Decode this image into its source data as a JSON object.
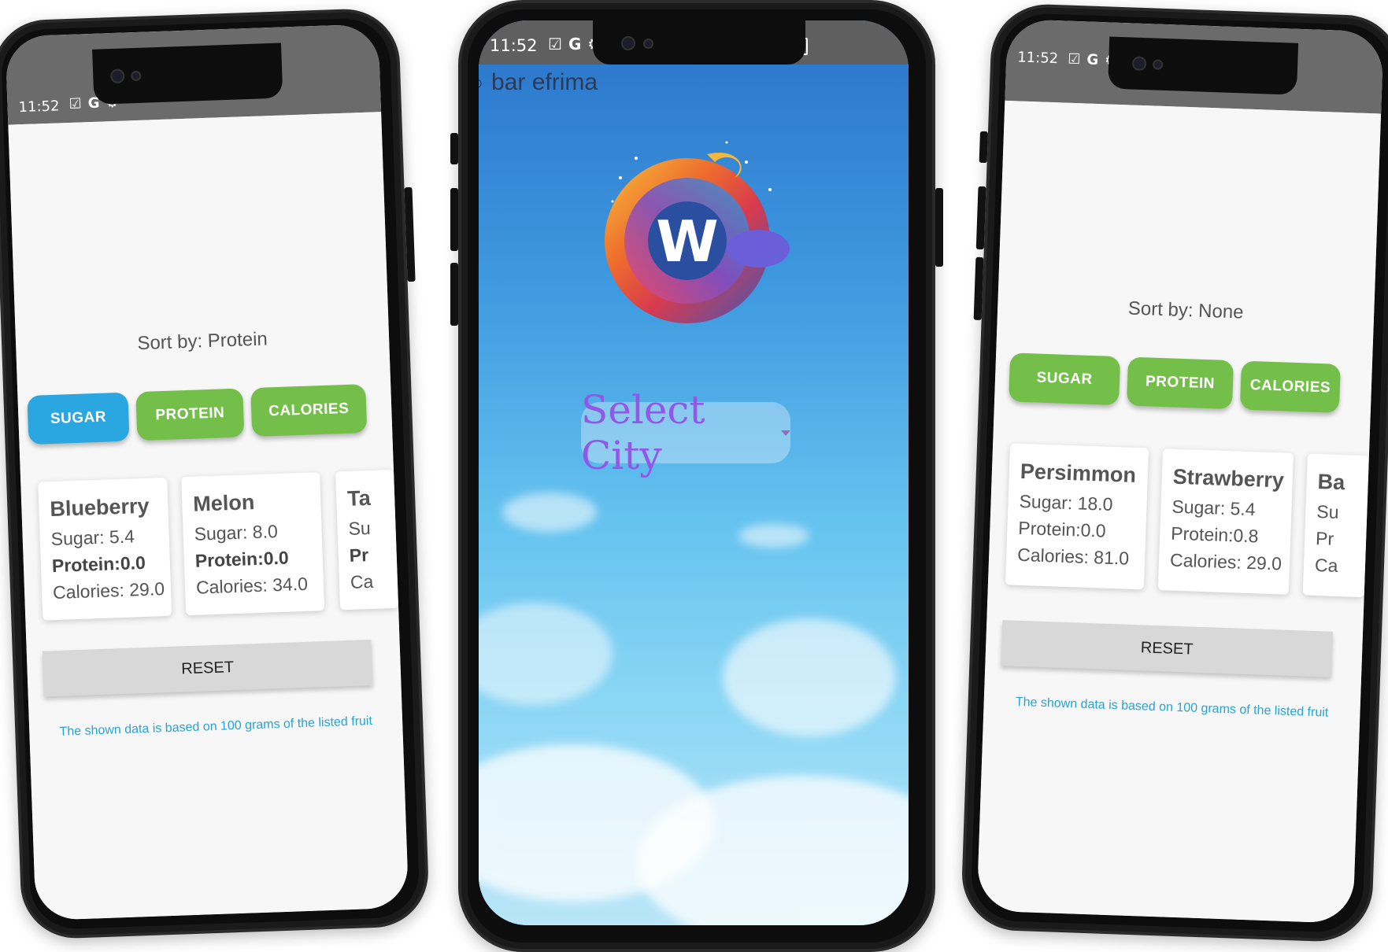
{
  "status_bar": {
    "time": "11:52"
  },
  "left_phone": {
    "sort_label": "Sort by: Protein",
    "buttons": [
      {
        "label": "SUGAR",
        "state": "active",
        "color": "#2aa6e0"
      },
      {
        "label": "PROTEIN",
        "state": "inactive",
        "color": "#74bf4a"
      },
      {
        "label": "CALORIES",
        "state": "inactive",
        "color": "#74bf4a"
      }
    ],
    "cards": [
      {
        "name": "Blueberry",
        "sugar": "Sugar: 5.4",
        "protein": "Protein:0.0",
        "calories": "Calories: 29.0"
      },
      {
        "name": "Melon",
        "sugar": "Sugar: 8.0",
        "protein": "Protein:0.0",
        "calories": "Calories: 34.0"
      },
      {
        "name": "Ta",
        "sugar": "Su",
        "protein": "Pr",
        "calories": "Ca"
      }
    ],
    "reset_label": "RESET",
    "note": "The shown data is based on 100 grams of the listed fruit"
  },
  "center_phone": {
    "appbar_title": "bar efrima",
    "logo_letter": "W",
    "select_label": "Select City"
  },
  "right_phone": {
    "sort_label": "Sort by: None",
    "buttons": [
      {
        "label": "SUGAR",
        "color": "#74bf4a"
      },
      {
        "label": "PROTEIN",
        "color": "#74bf4a"
      },
      {
        "label": "CALORIES",
        "color": "#74bf4a"
      }
    ],
    "cards": [
      {
        "name": "Persimmon",
        "sugar": "Sugar: 18.0",
        "protein": "Protein:0.0",
        "calories": "Calories: 81.0"
      },
      {
        "name": "Strawberry",
        "sugar": "Sugar: 5.4",
        "protein": "Protein:0.8",
        "calories": "Calories: 29.0"
      },
      {
        "name": "Ba",
        "sugar": "Su",
        "protein": "Pr",
        "calories": "Ca"
      }
    ],
    "reset_label": "RESET",
    "note": "The shown data is based on 100 grams of the listed fruit"
  }
}
